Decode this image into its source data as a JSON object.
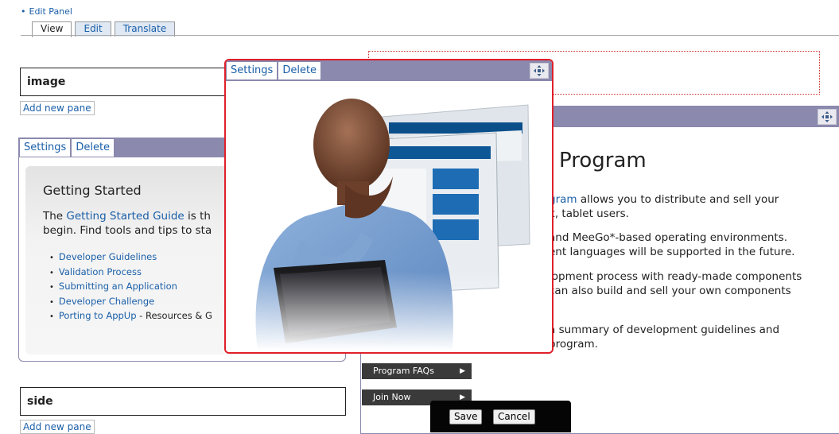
{
  "edit_panel": {
    "label": "Edit Panel"
  },
  "tabs": [
    {
      "label": "View",
      "active": true
    },
    {
      "label": "Edit",
      "active": false
    },
    {
      "label": "Translate",
      "active": false
    }
  ],
  "regions": {
    "image": {
      "title": "image",
      "add_pane": "Add new pane"
    },
    "side": {
      "title": "side",
      "add_pane": "Add new pane"
    }
  },
  "pane_controls": {
    "settings": "Settings",
    "delete": "Delete",
    "move_icon": "move-arrows-icon"
  },
  "getting_started": {
    "title": "Getting Started",
    "intro_pre": "The ",
    "intro_link": "Getting Started Guide",
    "intro_post": " is th",
    "intro_line2": "begin. Find tools and tips to sta",
    "links": [
      {
        "label": "Developer Guidelines",
        "suffix": ""
      },
      {
        "label": "Validation Process",
        "suffix": ""
      },
      {
        "label": "Submitting an Application",
        "suffix": ""
      },
      {
        "label": "Developer Challenge",
        "suffix": ""
      },
      {
        "label": "Porting to AppUp",
        "suffix": " - Resources & G"
      }
    ]
  },
  "program": {
    "title": "Program",
    "p1_link": "gram",
    "p1_a": " allows you to distribute and sell your",
    "p1_b": "k, tablet users.",
    "p2_a": " and MeeGo*-based operating environments.",
    "p2_b": "ent languages will be supported in the future.",
    "p3_a": "lopment process with ready-made components",
    "p3_b": " can also build and sell your own components",
    "p4_a": " a summary of development guidelines and",
    "p4_b": "program.",
    "buttons": [
      {
        "label": "Program FAQs"
      },
      {
        "label": "Join Now"
      }
    ]
  },
  "save_bar": {
    "save": "Save",
    "cancel": "Cancel"
  },
  "colors": {
    "pane_bar": "#8b89ad",
    "highlight_border": "#e0202a",
    "link": "#1a5fa8"
  }
}
